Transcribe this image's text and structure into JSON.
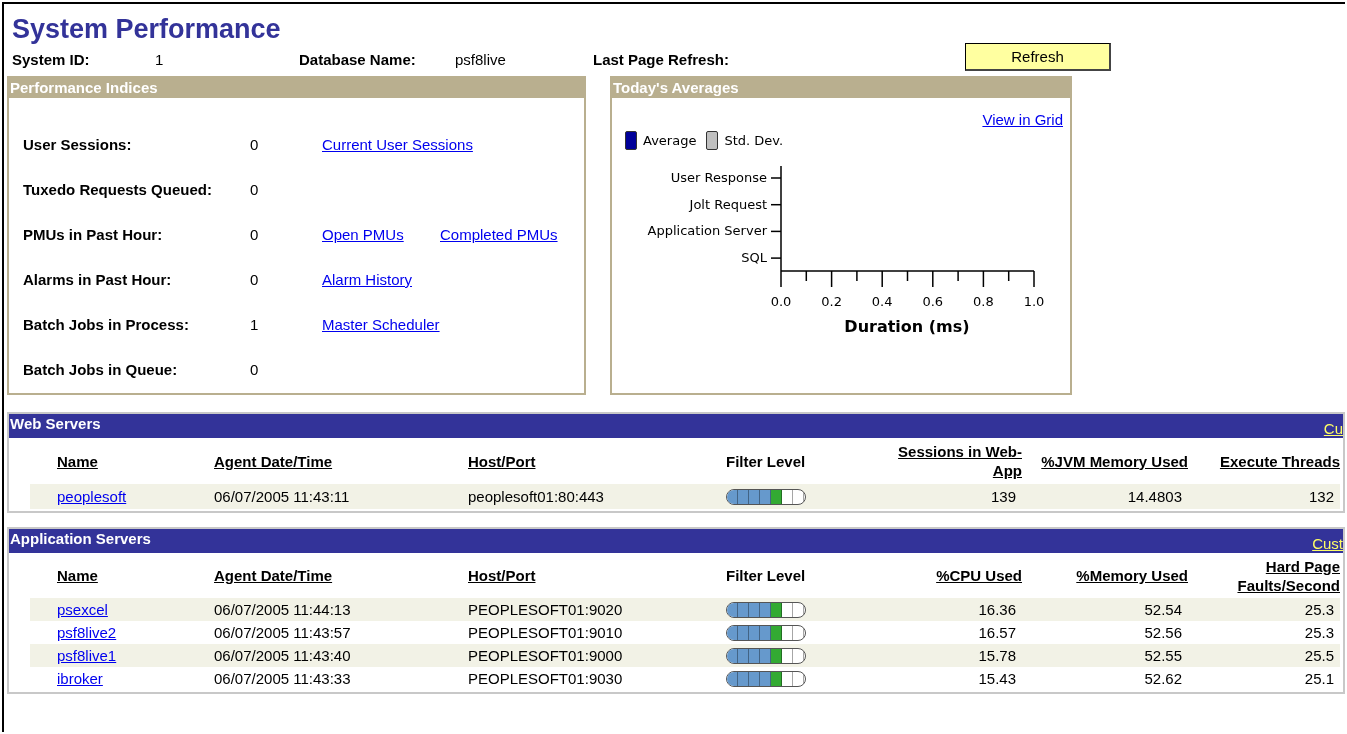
{
  "page_title": "System Performance",
  "header_fields": [
    {
      "label": "System ID:",
      "value": "1"
    },
    {
      "label": "Database Name:",
      "value": "psf8live"
    },
    {
      "label": "Last Page Refresh:"
    }
  ],
  "refresh_button": "Refresh",
  "performance_indices": {
    "title": "Performance Indices",
    "rows": [
      {
        "label": "User Sessions:",
        "value": "0",
        "links": [
          "Current User Sessions"
        ]
      },
      {
        "label": "Tuxedo Requests Queued:",
        "value": "0",
        "links": []
      },
      {
        "label": "PMUs in Past Hour:",
        "value": "0",
        "links": [
          "Open PMUs",
          "Completed PMUs"
        ]
      },
      {
        "label": "Alarms in Past Hour:",
        "value": "0",
        "links": [
          "Alarm History"
        ]
      },
      {
        "label": "Batch Jobs in Process:",
        "value": "1",
        "links": [
          "Master Scheduler"
        ]
      },
      {
        "label": "Batch Jobs in Queue:",
        "value": "0",
        "links": []
      }
    ]
  },
  "todays_averages": {
    "title": "Today's Averages",
    "link": "View in Grid",
    "chart_data": {
      "type": "bar",
      "orientation": "horizontal",
      "xlabel": "Duration (ms)",
      "categories": [
        "User Response",
        "Jolt Request",
        "Application Server",
        "SQL"
      ],
      "series": [
        {
          "name": "Average",
          "color": "#000099",
          "values": [
            null,
            null,
            null,
            null
          ]
        },
        {
          "name": "Std. Dev.",
          "color": "#c0c0c0",
          "values": [
            null,
            null,
            null,
            null
          ]
        }
      ],
      "xlim": [
        0,
        1
      ],
      "xticks": [
        {
          "value": 0,
          "label": "0.0"
        },
        {
          "value": 0.2,
          "label": "0.2"
        },
        {
          "value": 0.4,
          "label": "0.4"
        },
        {
          "value": 0.6,
          "label": "0.6"
        },
        {
          "value": 0.8,
          "label": "0.8"
        },
        {
          "value": 1,
          "label": "1.0"
        }
      ]
    }
  },
  "web_servers": {
    "title": "Web Servers",
    "header_link": "Cu",
    "columns": [
      "Name",
      "Agent Date/Time",
      "Host/Port",
      "Filter Level",
      "Sessions in Web-App",
      "%JVM Memory Used",
      "Execute Threads"
    ],
    "rows": [
      {
        "name": "peoplesoft",
        "agent_time": "06/07/2005 11:43:11",
        "host_port": "peoplesoft01:80:443",
        "level": 0.71,
        "values": [
          "139",
          "14.4803",
          "132"
        ]
      }
    ]
  },
  "application_servers": {
    "title": "Application Servers",
    "header_link": "Cust",
    "columns": [
      "Name",
      "Agent Date/Time",
      "Host/Port",
      "Filter Level",
      "%CPU Used",
      "%Memory Used",
      "Hard Page Faults/Second"
    ],
    "rows": [
      {
        "name": "psexcel",
        "agent_time": "06/07/2005 11:44:13",
        "host_port": "PEOPLESOFT01:9020",
        "level": 0.71,
        "values": [
          "16.36",
          "52.54",
          "25.3"
        ]
      },
      {
        "name": "psf8live2",
        "agent_time": "06/07/2005 11:43:57",
        "host_port": "PEOPLESOFT01:9010",
        "level": 0.71,
        "values": [
          "16.57",
          "52.56",
          "25.3"
        ]
      },
      {
        "name": "psf8live1",
        "agent_time": "06/07/2005 11:43:40",
        "host_port": "PEOPLESOFT01:9000",
        "level": 0.71,
        "values": [
          "15.78",
          "52.55",
          "25.5"
        ]
      },
      {
        "name": "ibroker",
        "agent_time": "06/07/2005 11:43:33",
        "host_port": "PEOPLESOFT01:9030",
        "level": 0.71,
        "values": [
          "15.43",
          "52.62",
          "25.1"
        ]
      }
    ]
  }
}
